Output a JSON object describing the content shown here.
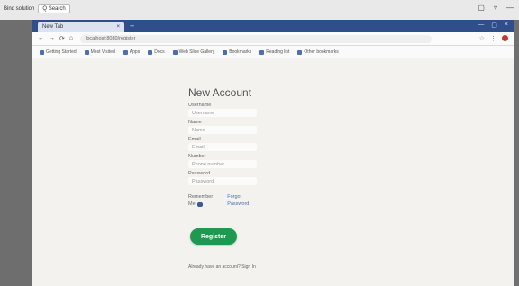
{
  "os": {
    "left_label": "Bind solution",
    "chip_label": "Q Search",
    "controls": [
      "▢",
      "▿",
      "—"
    ]
  },
  "browser": {
    "tab_title": "New Tab",
    "tab_close": "×",
    "new_tab": "+",
    "window_controls": [
      "—",
      "▢",
      "×"
    ],
    "nav_icons": [
      "←",
      "→",
      "⟳",
      "⌂"
    ],
    "url": "localhost:8080/register",
    "right_icons": [
      "☆",
      "⋮"
    ],
    "bookmarks": [
      "Getting Started",
      "Most Visited",
      "Apps",
      "Docs",
      "Web Slice Gallery",
      "Bookmarks",
      "Reading list",
      "Other bookmarks"
    ]
  },
  "form": {
    "title": "New Account",
    "fields": [
      {
        "label": "Username",
        "placeholder": "Username"
      },
      {
        "label": "Name",
        "placeholder": "Name"
      },
      {
        "label": "Email",
        "placeholder": "Email"
      },
      {
        "label": "Number",
        "placeholder": "Phone number"
      },
      {
        "label": "Password",
        "placeholder": "Password"
      }
    ],
    "remember_label": "Remember",
    "remember_value": "Me",
    "forgot_line1": "Forgot",
    "forgot_line2": "Password",
    "register_label": "Register",
    "bottom_text": "Already have an account? Sign In"
  }
}
